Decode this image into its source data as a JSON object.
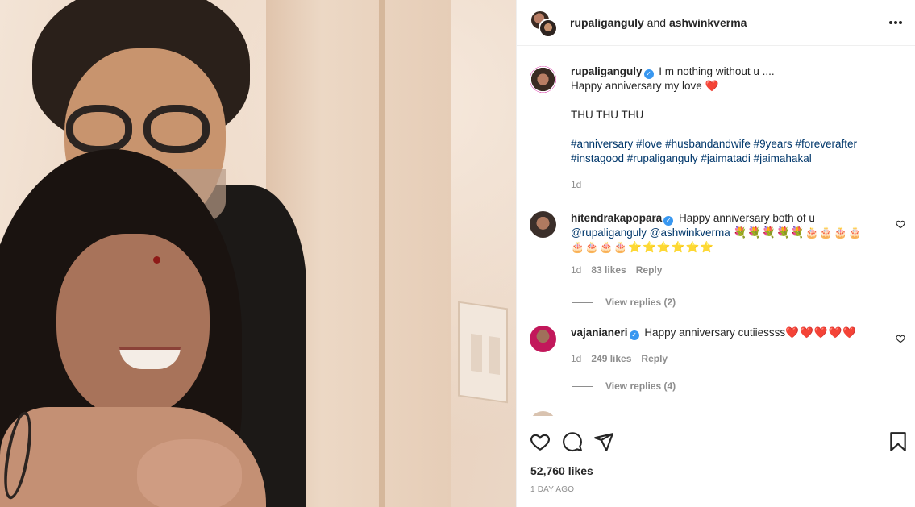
{
  "header": {
    "user1": "rupaliganguly",
    "and": " and ",
    "user2": "ashwinkverma"
  },
  "caption": {
    "username": "rupaliganguly",
    "line1": "I m nothing without u ....",
    "line2": "Happy anniversary my love",
    "line2_emoji": "❤️",
    "line3": "THU THU THU",
    "hashtags_line1": "#anniversary #love #husbandandwife #9years #foreverafter",
    "hashtags_line2": "#instagood #rupaliganguly #jaimatadi #jaimahakal",
    "time": "1d"
  },
  "comments": [
    {
      "username": "hitendrakapopara",
      "text": "Happy anniversary both of u",
      "mentions": "@rupaliganguly @ashwinkverma",
      "emojis1": "💐💐💐💐💐🎂🎂🎂🎂",
      "emojis2": "🎂🎂🎂🎂⭐⭐⭐⭐⭐⭐",
      "time": "1d",
      "likes": "83 likes",
      "reply": "Reply",
      "view_replies": "View replies (2)"
    },
    {
      "username": "vajanianeri",
      "text": "Happy anniversary cutiiessss",
      "emojis": "❤️❤️❤️❤️❤️",
      "time": "1d",
      "likes": "249 likes",
      "reply": "Reply",
      "view_replies": "View replies (4)"
    }
  ],
  "footer": {
    "likes": "52,760 likes",
    "ago": "1 DAY AGO"
  },
  "colors": {
    "verified": "#3897f0",
    "link": "#00376b",
    "muted": "#8e8e8e",
    "heart": "#ed4956"
  },
  "icons": [
    "heart-icon",
    "comment-icon",
    "share-icon",
    "bookmark-icon",
    "more-options-icon",
    "verified-badge-icon"
  ]
}
